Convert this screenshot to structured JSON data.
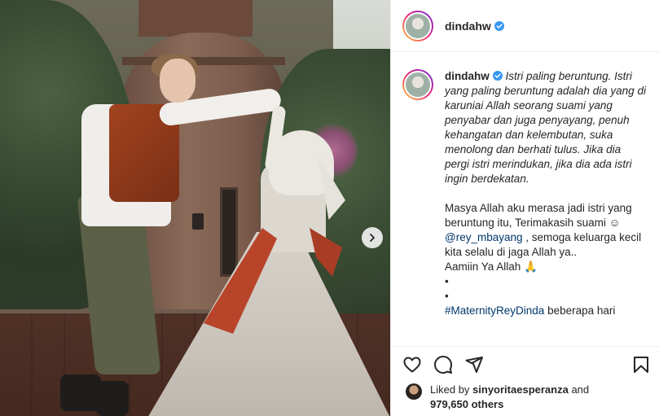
{
  "post": {
    "username": "dindahw",
    "verified": true
  },
  "caption": {
    "username": "dindahw",
    "line_1": "Istri paling beruntung. Istri yang paling beruntung adalah dia yang di karuniai Allah seorang suami yang penyabar dan juga penyayang, penuh kehangatan dan kelembutan, suka menolong dan berhati tulus. Jika dia pergi istri merindukan, jika dia ada istri ingin berdekatan.",
    "para_2a": "Masya Allah aku merasa jadi istri yang beruntung itu, Terimakasih suami ☺",
    "mention": "@rey_mbayang",
    "para_2b": ", semoga keluarga kecil kita selalu di jaga Allah ya..",
    "amin": "Aamiin Ya Allah 🙏",
    "dot": "•",
    "hashtag": "#MaternityReyDinda",
    "after_hashtag": "beberapa hari"
  },
  "likes": {
    "liked_by_prefix": "Liked by",
    "liked_by_user": "sinyoritaesperanza",
    "and": "and",
    "others_count": "979,650 others"
  },
  "icons": {
    "like": "heart-icon",
    "comment": "comment-icon",
    "share": "send-icon",
    "save": "bookmark-icon",
    "next": "chevron-right-icon",
    "verified": "verified-badge-icon"
  },
  "colors": {
    "verified_blue": "#3897f0",
    "link_blue": "#00376b",
    "text": "#262626"
  }
}
